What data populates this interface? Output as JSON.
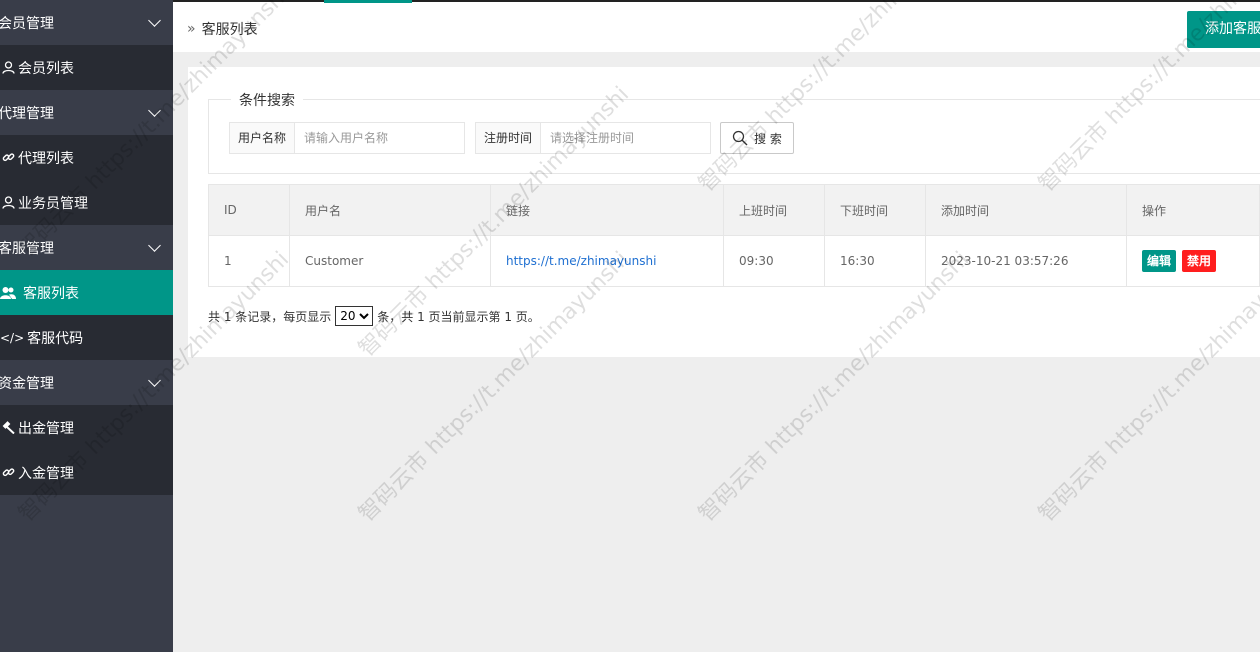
{
  "sidebar": {
    "groups": [
      {
        "label": "会员管理",
        "items": [
          {
            "label": "会员列表",
            "icon": "user-icon"
          }
        ]
      },
      {
        "label": "代理管理",
        "items": [
          {
            "label": "代理列表",
            "icon": "link-icon"
          },
          {
            "label": "业务员管理",
            "icon": "user-icon"
          }
        ]
      },
      {
        "label": "客服管理",
        "items": [
          {
            "label": "客服列表",
            "icon": "users-icon",
            "active": true
          },
          {
            "label": "客服代码",
            "icon": "code-icon"
          }
        ]
      },
      {
        "label": "资金管理",
        "items": [
          {
            "label": "出金管理",
            "icon": "hammer-icon"
          },
          {
            "label": "入金管理",
            "icon": "link-icon"
          }
        ]
      }
    ]
  },
  "topbar": {
    "breadcrumb": "客服列表",
    "add_button": "添加客服"
  },
  "search": {
    "legend": "条件搜索",
    "username_label": "用户名称",
    "username_placeholder": "请输入用户名称",
    "regtime_label": "注册时间",
    "regtime_placeholder": "请选择注册时间",
    "button": "搜 索"
  },
  "table": {
    "headers": [
      "ID",
      "用户名",
      "链接",
      "上班时间",
      "下班时间",
      "添加时间",
      "操作"
    ],
    "rows": [
      {
        "id": "1",
        "username": "Customer",
        "link": "https://t.me/zhimayunshi",
        "start": "09:30",
        "end": "16:30",
        "added": "2023-10-21 03:57:26",
        "edit": "编辑",
        "ban": "禁用"
      }
    ]
  },
  "pager": {
    "prefix": "共 1 条记录，每页显示",
    "page_size": "20",
    "suffix": "条，共 1 页当前显示第 1 页。"
  },
  "watermark": "智码云市 https://t.me/zhimayunshi",
  "colors": {
    "sidebar": "#393d49",
    "sidebar_item": "#282b33",
    "accent": "#009688",
    "danger": "#ff1e1e"
  }
}
